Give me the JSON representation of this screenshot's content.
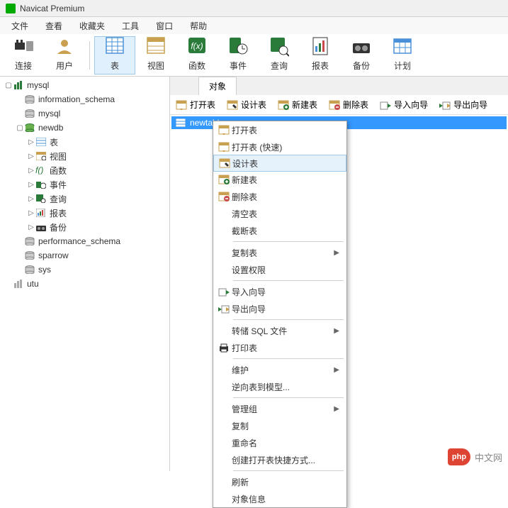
{
  "title": "Navicat Premium",
  "menubar": [
    "文件",
    "查看",
    "收藏夹",
    "工具",
    "窗口",
    "帮助"
  ],
  "toolbar": [
    {
      "label": "连接",
      "icon": "plug"
    },
    {
      "label": "用户",
      "icon": "user"
    },
    {
      "label": "表",
      "icon": "table",
      "active": true
    },
    {
      "label": "视图",
      "icon": "view"
    },
    {
      "label": "函数",
      "icon": "fx"
    },
    {
      "label": "事件",
      "icon": "clock"
    },
    {
      "label": "查询",
      "icon": "query"
    },
    {
      "label": "报表",
      "icon": "report"
    },
    {
      "label": "备份",
      "icon": "backup"
    },
    {
      "label": "计划",
      "icon": "schedule"
    }
  ],
  "tree": [
    {
      "label": "mysql",
      "indent": 0,
      "icon": "db-green",
      "expand": "▢"
    },
    {
      "label": "information_schema",
      "indent": 1,
      "icon": "schema"
    },
    {
      "label": "mysql",
      "indent": 1,
      "icon": "schema"
    },
    {
      "label": "newdb",
      "indent": 1,
      "icon": "schema-open",
      "expand": "▢"
    },
    {
      "label": "表",
      "indent": 2,
      "icon": "table-sm",
      "expand": "▷"
    },
    {
      "label": "视图",
      "indent": 2,
      "icon": "view-sm",
      "expand": "▷"
    },
    {
      "label": "函数",
      "indent": 2,
      "icon": "fx-sm",
      "expand": "▷"
    },
    {
      "label": "事件",
      "indent": 2,
      "icon": "clock-sm",
      "expand": "▷"
    },
    {
      "label": "查询",
      "indent": 2,
      "icon": "query-sm",
      "expand": "▷"
    },
    {
      "label": "报表",
      "indent": 2,
      "icon": "report-sm",
      "expand": "▷"
    },
    {
      "label": "备份",
      "indent": 2,
      "icon": "backup-sm",
      "expand": "▷"
    },
    {
      "label": "performance_schema",
      "indent": 1,
      "icon": "schema"
    },
    {
      "label": "sparrow",
      "indent": 1,
      "icon": "schema"
    },
    {
      "label": "sys",
      "indent": 1,
      "icon": "schema"
    },
    {
      "label": "utu",
      "indent": 0,
      "icon": "db-gray"
    }
  ],
  "tab_label": "对象",
  "sub_toolbar": [
    {
      "label": "打开表",
      "icon": "open"
    },
    {
      "label": "设计表",
      "icon": "design"
    },
    {
      "label": "新建表",
      "icon": "new"
    },
    {
      "label": "删除表",
      "icon": "delete"
    },
    {
      "label": "导入向导",
      "icon": "import"
    },
    {
      "label": "导出向导",
      "icon": "export"
    }
  ],
  "selected_table": "newtable",
  "context_menu": [
    {
      "label": "打开表",
      "icon": "open"
    },
    {
      "label": "打开表 (快速)",
      "icon": "open"
    },
    {
      "label": "设计表",
      "icon": "design",
      "hovered": true
    },
    {
      "label": "新建表",
      "icon": "new"
    },
    {
      "label": "删除表",
      "icon": "delete"
    },
    {
      "label": "清空表"
    },
    {
      "label": "截断表"
    },
    {
      "sep": true
    },
    {
      "label": "复制表",
      "submenu": true
    },
    {
      "label": "设置权限"
    },
    {
      "sep": true
    },
    {
      "label": "导入向导",
      "icon": "import"
    },
    {
      "label": "导出向导",
      "icon": "export"
    },
    {
      "sep": true
    },
    {
      "label": "转储 SQL 文件",
      "submenu": true
    },
    {
      "label": "打印表",
      "icon": "print"
    },
    {
      "sep": true
    },
    {
      "label": "维护",
      "submenu": true
    },
    {
      "label": "逆向表到模型..."
    },
    {
      "sep": true
    },
    {
      "label": "管理组",
      "submenu": true
    },
    {
      "label": "复制"
    },
    {
      "label": "重命名"
    },
    {
      "label": "创建打开表快捷方式..."
    },
    {
      "sep": true
    },
    {
      "label": "刷新"
    },
    {
      "label": "对象信息"
    }
  ],
  "watermark": {
    "badge": "php",
    "text": "中文网"
  }
}
